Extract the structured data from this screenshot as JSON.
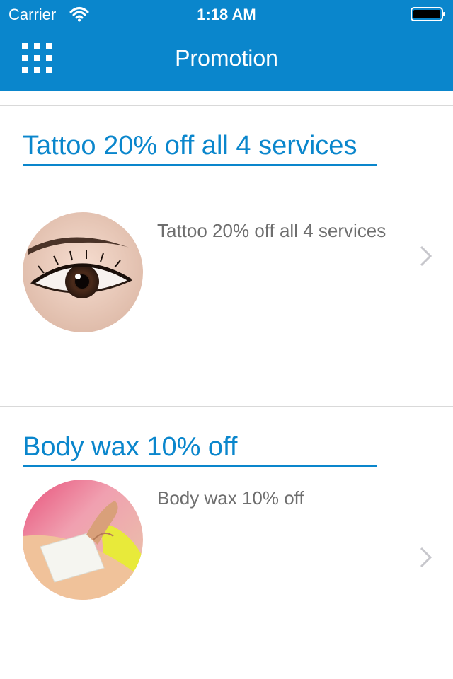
{
  "status_bar": {
    "carrier": "Carrier",
    "time": "1:18 AM",
    "wifi_icon": "wifi-icon",
    "battery_icon": "battery-icon"
  },
  "nav": {
    "title": "Promotion",
    "menu_icon": "grid-menu-icon"
  },
  "colors": {
    "accent": "#0a86cc",
    "description_text": "#6e6e6e",
    "divider": "#d9d9d9"
  },
  "promotions": [
    {
      "title": "Tattoo 20% off all 4 services",
      "description": "Tattoo 20% off all 4 services",
      "image": "eye-photo",
      "chevron_icon": "chevron-right-icon"
    },
    {
      "title": "Body wax 10% off",
      "description": "Body wax 10% off",
      "image": "body-wax-photo",
      "chevron_icon": "chevron-right-icon"
    }
  ]
}
